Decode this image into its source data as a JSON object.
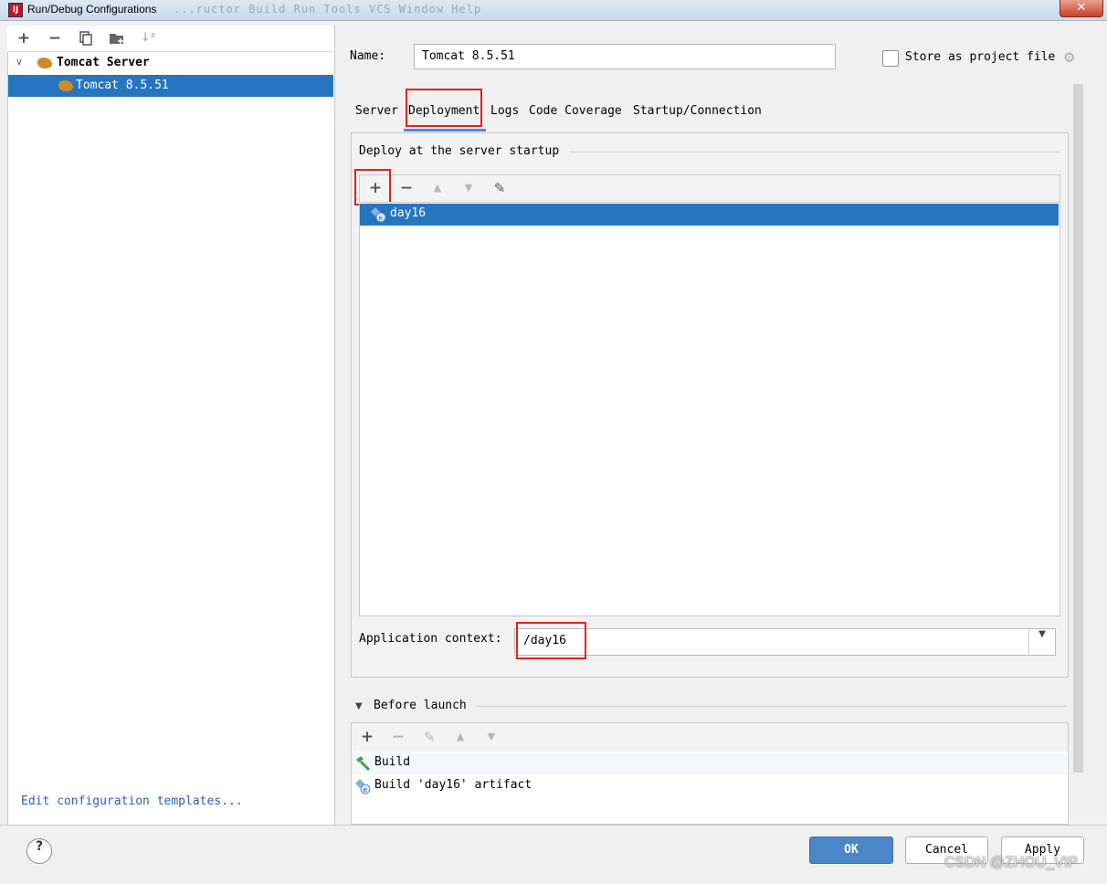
{
  "window": {
    "title": "Run/Debug Configurations",
    "background_menu_ghost": "...ructor  Build  Run  Tools  VCS  Window  Help",
    "close_glyph": "✕"
  },
  "left": {
    "toolbar": [
      "+",
      "−",
      "copy",
      "folder-plus",
      "sort-az"
    ],
    "tree": {
      "group": "Tomcat Server",
      "item": "Tomcat 8.5.51"
    },
    "edit_templates_link": "Edit configuration templates..."
  },
  "form": {
    "name_label": "Name:",
    "name_value": "Tomcat 8.5.51",
    "store_label": "Store as project file",
    "tabs": [
      "Server",
      "Deployment",
      "Logs",
      "Code Coverage",
      "Startup/Connection"
    ],
    "active_tab": "Deployment",
    "deploy_group_title": "Deploy at the server startup",
    "deploy_items": [
      "day16"
    ],
    "app_context_label": "Application context:",
    "app_context_value": "/day16",
    "before_launch_title": "Before launch",
    "before_launch_items": [
      "Build",
      "Build 'day16' artifact"
    ]
  },
  "footer": {
    "help": "?",
    "ok": "OK",
    "cancel": "Cancel",
    "apply": "Apply"
  },
  "watermark": "CSDN @ZHOU_VIP",
  "colors": {
    "selection": "#2675bf",
    "highlight_red": "#e0231d",
    "tab_underline": "#4a8ad8",
    "link": "#2a60b0",
    "ok_button": "#4a86c8"
  }
}
